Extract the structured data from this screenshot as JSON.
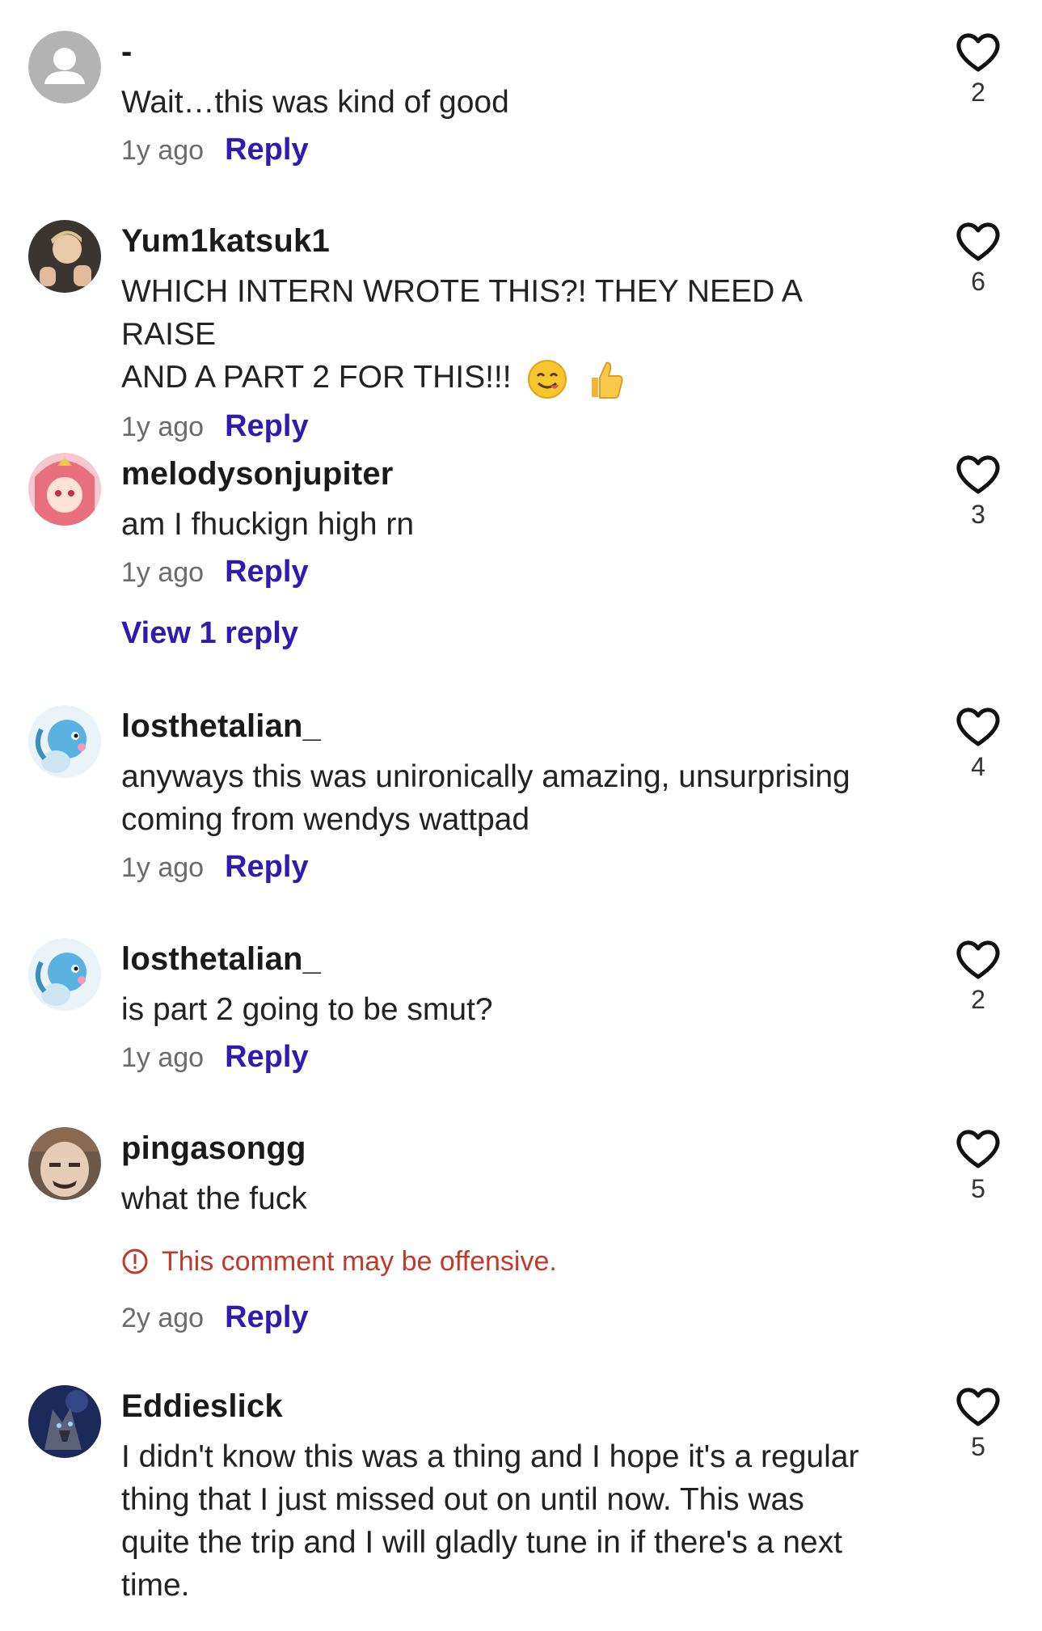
{
  "comments": [
    {
      "username": "-",
      "text": "Wait…this was kind of good",
      "time": "1y ago",
      "reply": "Reply",
      "likes": "2",
      "avatar": "default-user-icon"
    },
    {
      "username": "Yum1katsuk1",
      "text_line1": "WHICH INTERN WROTE THIS?! THEY NEED A RAISE",
      "text_line2": "AND A PART 2 FOR THIS!!!",
      "time": "1y ago",
      "reply": "Reply",
      "likes": "6",
      "emojis": [
        "yum-face-emoji",
        "thumbs-up-emoji"
      ]
    },
    {
      "username": "melodysonjupiter",
      "text": "am I fhuckign high rn",
      "time": "1y ago",
      "reply": "Reply",
      "likes": "3",
      "view_replies": "View 1 reply"
    },
    {
      "username": "losthetalian_",
      "text_line1": "anyways this was unironically amazing, unsurprising",
      "text_line2": "coming from wendys wattpad",
      "time": "1y ago",
      "reply": "Reply",
      "likes": "4"
    },
    {
      "username": "losthetalian_",
      "text": "is part 2 going to be smut?",
      "time": "1y ago",
      "reply": "Reply",
      "likes": "2"
    },
    {
      "username": "pingasongg",
      "text": "what the fuck",
      "warning": "This comment may be offensive.",
      "time": "2y ago",
      "reply": "Reply",
      "likes": "5"
    },
    {
      "username": "Eddieslick",
      "text_line1": "I didn't know this was a thing and I hope it's a regular",
      "text_line2": "thing that I just missed out on until now. This was",
      "text_line3": "quite the trip and I will gladly tune in if there's a next",
      "text_line4": "time.",
      "likes": "5"
    }
  ],
  "colors": {
    "reply": "#2f1bb0",
    "warning": "#c0392b",
    "time": "#6b6b6b"
  }
}
